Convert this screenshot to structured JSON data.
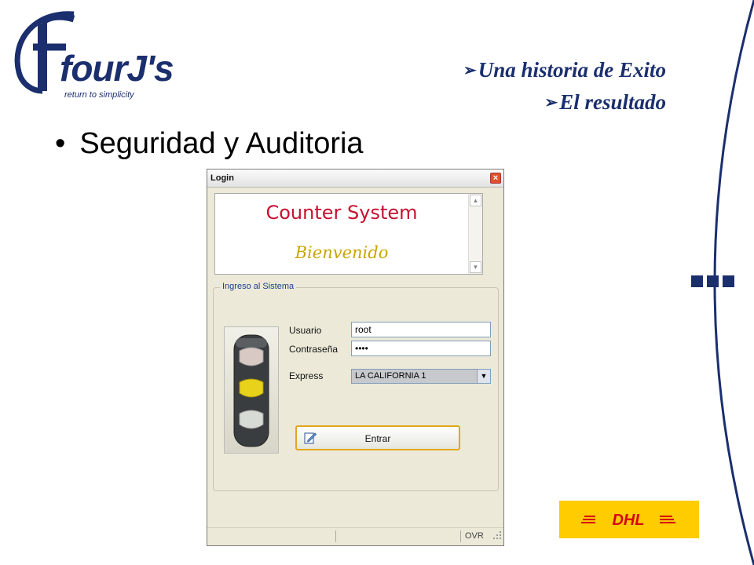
{
  "slide": {
    "brand_name": "fourJ's",
    "tagline": "return to simplicity",
    "headline_1": "Una historia de Exito",
    "headline_2": "El resultado",
    "bullet_text": "Seguridad y Auditoria",
    "dhl_logo_text": "DHL",
    "accent_color": "#1b2f6e",
    "dhl_yellow": "#ffcc00",
    "dhl_red": "#d40511"
  },
  "window": {
    "title": "Login",
    "close_label": "×",
    "banner": {
      "system_name": "Counter System",
      "welcome": "Bienvenido"
    },
    "group_title": "Ingreso al Sistema",
    "form": {
      "user_label": "Usuario",
      "user_value": "root",
      "password_label": "Contraseña",
      "password_value": "••••",
      "express_label": "Express",
      "express_value": "LA CALIFORNIA 1"
    },
    "enter_label": "Entrar",
    "status": {
      "mode": "OVR"
    },
    "icons": [
      "close-icon",
      "traffic-light-icon",
      "login-edit-icon",
      "scroll-up-icon",
      "scroll-down-icon",
      "size-grip-icon"
    ]
  }
}
